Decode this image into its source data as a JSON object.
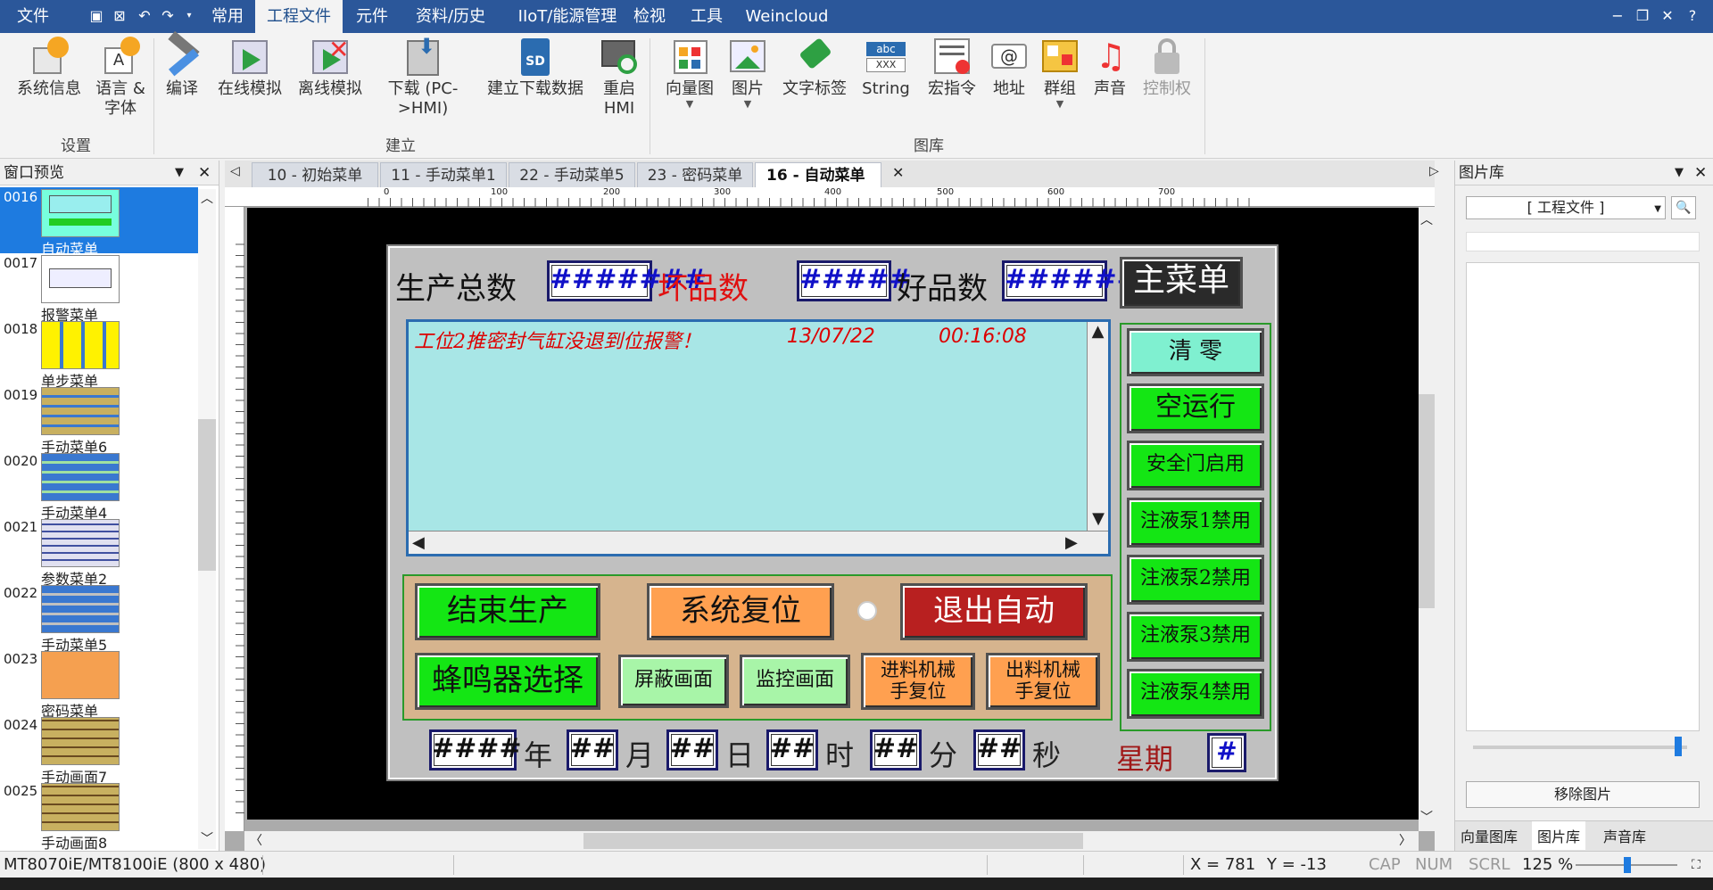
{
  "menubar": {
    "items": [
      "文件",
      "常用",
      "工程文件",
      "元件",
      "资料/历史",
      "IIoT/能源管理",
      "检视",
      "工具",
      "Weincloud"
    ],
    "active": "工程文件"
  },
  "ribbon": {
    "settings": {
      "label": "设置",
      "buttons": [
        "系统信息",
        "语言 &",
        "字体"
      ]
    },
    "build": {
      "label": "建立",
      "compile": "编译",
      "online": "在线模拟",
      "offline": "离线模拟",
      "download1": "下载 (PC-",
      "download2": ">HMI)",
      "builddl": "建立下载数据",
      "restart1": "重启",
      "restart2": "HMI"
    },
    "library": {
      "label": "图库",
      "vector": "向量图",
      "picture": "图片",
      "textlabel": "文字标签",
      "string": "String",
      "macro": "宏指令",
      "address": "地址",
      "group": "群组",
      "sound": "声音",
      "control": "控制权"
    }
  },
  "leftpanel": {
    "title": "窗口预览",
    "thumbs": [
      {
        "num": "0016",
        "label": "自动菜单"
      },
      {
        "num": "0017",
        "label": "报警菜单"
      },
      {
        "num": "0018",
        "label": "单步菜单"
      },
      {
        "num": "0019",
        "label": "手动菜单6"
      },
      {
        "num": "0020",
        "label": "手动菜单4"
      },
      {
        "num": "0021",
        "label": "参数菜单2"
      },
      {
        "num": "0022",
        "label": "手动菜单5"
      },
      {
        "num": "0023",
        "label": "密码菜单"
      },
      {
        "num": "0024",
        "label": "手动画面7"
      },
      {
        "num": "0025",
        "label": "手动画面8"
      }
    ]
  },
  "tabs": [
    "10 - 初始菜单",
    "11 - 手动菜单1",
    "22 - 手动菜单5",
    "23 - 密码菜单",
    "16 - 自动菜单"
  ],
  "ruler": [
    "0",
    "100",
    "200",
    "300",
    "400",
    "500",
    "600",
    "700"
  ],
  "hmi": {
    "total_label": "生产总数",
    "total_val": "#######",
    "bad_label": "坏品数",
    "bad_val": "#####",
    "good_label": "好品数",
    "good_val": "#######",
    "main_menu": "主菜单",
    "alarm_msg": "工位2推密封气缸没退到位报警！",
    "alarm_date": "13/07/22",
    "alarm_time": "00:16:08",
    "clear": "清 零",
    "dry_run": "空运行",
    "safety_door": "安全门启用",
    "pump1": "注液泵1禁用",
    "pump2": "注液泵2禁用",
    "pump3": "注液泵3禁用",
    "pump4": "注液泵4禁用",
    "end_prod": "结束生产",
    "sys_reset": "系统复位",
    "exit_auto": "退出自动",
    "buzzer": "蜂鸣器选择",
    "shield": "屏蔽画面",
    "monitor": "监控画面",
    "in_reset1": "进料机械",
    "in_reset2": "手复位",
    "out_reset1": "出料机械",
    "out_reset2": "手复位",
    "year_val": "####",
    "year": "年",
    "mon_val": "##",
    "mon": "月",
    "day_val": "##",
    "day": "日",
    "hour_val": "##",
    "hour": "时",
    "min_val": "##",
    "min": "分",
    "sec_val": "##",
    "sec": "秒",
    "week": "星期",
    "week_val": "#"
  },
  "rightpanel": {
    "title": "图片库",
    "dropdown": "[ 工程文件 ]",
    "remove": "移除图片",
    "tabs": [
      "向量图库",
      "图片库",
      "声音库"
    ]
  },
  "status": {
    "model": "MT8070iE/MT8100iE (800 x 480)",
    "x": "X = 781",
    "y": "Y = -13",
    "cap": "CAP",
    "num": "NUM",
    "scrl": "SCRL",
    "zoom": "125 %"
  },
  "colors": {
    "accent": "#2b579a",
    "hmi_green": "#14e614",
    "alarm_bg": "#a8e6e6"
  }
}
